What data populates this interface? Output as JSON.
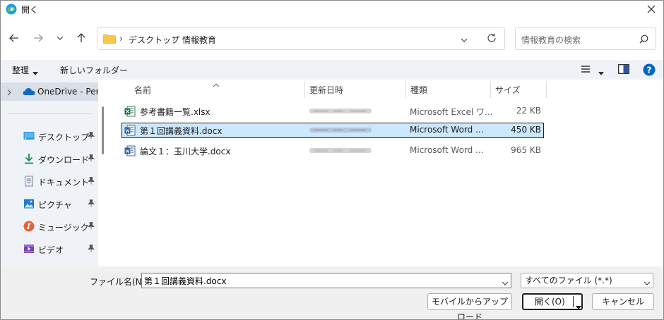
{
  "window": {
    "title": "開く"
  },
  "address": {
    "crumbs": [
      "デスクトップ",
      "情報教育"
    ],
    "separator": "›"
  },
  "search": {
    "placeholder": "情報教育の検索"
  },
  "commandbar": {
    "organize": "整理",
    "new_folder": "新しいフォルダー"
  },
  "navpane": {
    "onedrive": "OneDrive - Personal",
    "items": [
      {
        "label": "デスクトップ",
        "icon": "desktop-icon"
      },
      {
        "label": "ダウンロード",
        "icon": "download-icon"
      },
      {
        "label": "ドキュメント",
        "icon": "documents-icon"
      },
      {
        "label": "ピクチャ",
        "icon": "pictures-icon"
      },
      {
        "label": "ミュージック",
        "icon": "music-icon"
      },
      {
        "label": "ビデオ",
        "icon": "videos-icon"
      }
    ]
  },
  "columns": {
    "name": "名前",
    "modified": "更新日時",
    "type": "種類",
    "size": "サイズ"
  },
  "files": [
    {
      "name": "参考書籍一覧.xlsx",
      "icon": "excel-icon",
      "type": "Microsoft Excel ワ...",
      "size": "22 KB",
      "selected": false
    },
    {
      "name": "第１回講義資料.docx",
      "icon": "word-icon",
      "type": "Microsoft Word ...",
      "size": "450 KB",
      "selected": true
    },
    {
      "name": "論文１：玉川大学.docx",
      "icon": "word-icon",
      "type": "Microsoft Word ...",
      "size": "965 KB",
      "selected": false
    }
  ],
  "bottom": {
    "filename_label": "ファイル名(N):",
    "filename_value": "第１回講義資料.docx",
    "filetype": "すべてのファイル (*.*)",
    "upload_button": "モバイルからアップロード",
    "open_button": "開く(O)",
    "cancel_button": "キャンセル"
  },
  "colors": {
    "accent": "#0067c0",
    "selection": "#cce8ff",
    "pane_bg": "#eff3f8",
    "excel": "#1d6f42",
    "word": "#2b579a",
    "folder": "#f8c948"
  }
}
